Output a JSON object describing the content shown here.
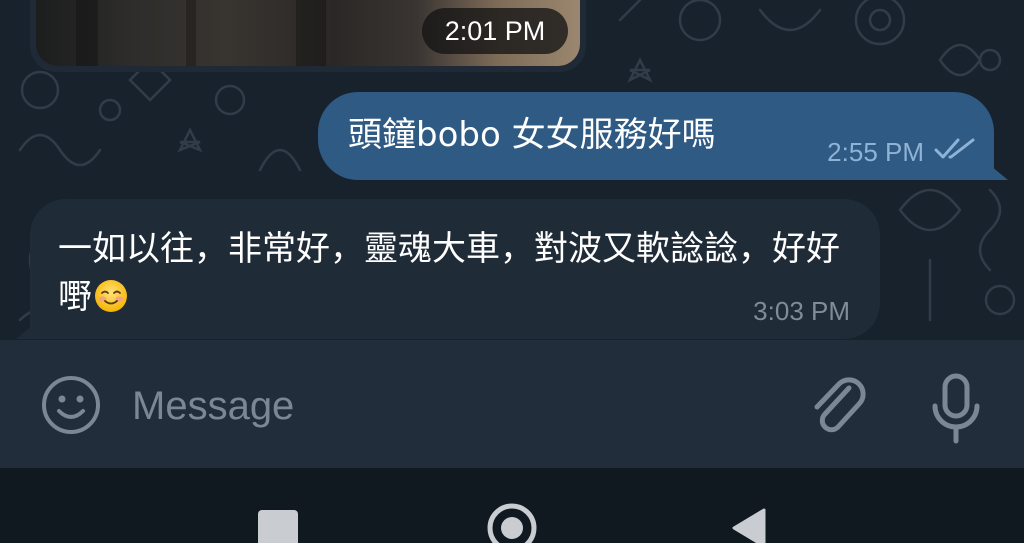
{
  "chat": {
    "media": {
      "time": "2:01 PM"
    },
    "outgoing": {
      "text": "頭鐘bobo 女女服務好嗎",
      "time": "2:55 PM",
      "status_icon": "double-check-icon",
      "bubble_color": "#2e5a84"
    },
    "incoming": {
      "text": "一如以往，非常好，靈魂大車，對波又軟諗諗，好好嘢",
      "emoji": "smiling-face-icon",
      "time": "3:03 PM",
      "bubble_color": "#1f2b37"
    }
  },
  "input_bar": {
    "placeholder": "Message",
    "emoji_icon": "smiley-icon",
    "attach_icon": "paperclip-icon",
    "mic_icon": "microphone-icon"
  },
  "nav_bar": {
    "recents_icon": "square-icon",
    "home_icon": "home-circle-icon",
    "back_icon": "back-triangle-icon"
  },
  "colors": {
    "chat_background": "#18222d",
    "input_background": "#212d3b",
    "nav_background": "#101820",
    "read_check": "#8fb3d6"
  }
}
